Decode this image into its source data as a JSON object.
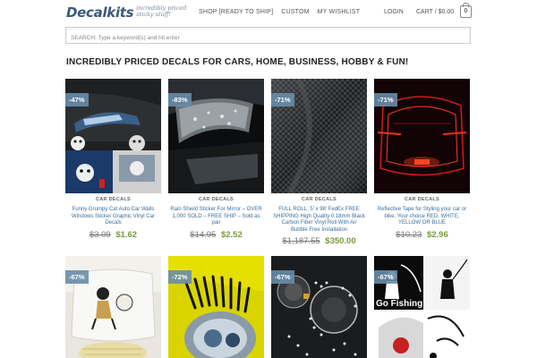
{
  "header": {
    "logo_text": "Decalkits",
    "logo_tagline_1": "incredibly priced",
    "logo_tagline_2": "sticky stuff!",
    "nav": [
      "SHOP [READY TO SHIP]",
      "CUSTOM",
      "MY WISHLIST"
    ],
    "login": "LOGIN",
    "cart_label": "CART / $0.00",
    "cart_count": "0"
  },
  "search": {
    "placeholder": "SEARCH: Type a keyword(s) and hit enter"
  },
  "page_heading": "INCREDIBLY PRICED DECALS FOR CARS, HOME, BUSINESS, HOBBY & FUN!",
  "products": [
    {
      "badge": "-47%",
      "category": "CAR DECALS",
      "name": "Funny Grumpy Cat Auto Car Walls Windows Sticker Graphic Vinyl Car Decals",
      "old_price": "$3.09",
      "new_price": "$1.62",
      "image_overlay": ""
    },
    {
      "badge": "-83%",
      "category": "CAR DECALS",
      "name": "Rain Shield Sticker For Mirror – OVER 1,000 SOLD – FREE SHIP – Sold as pair",
      "old_price": "$14.95",
      "new_price": "$2.52",
      "image_overlay": ""
    },
    {
      "badge": "-71%",
      "category": "CAR DECALS",
      "name": "FULL ROLL: 5' x 98' FedEx FREE SHIPPING High Quality 0.18mm Black Carbon Fiber Vinyl Roll With Air Bubble Free Installation",
      "old_price": "$1,187.55",
      "new_price": "$350.00",
      "image_overlay": ""
    },
    {
      "badge": "-71%",
      "category": "CAR DECALS",
      "name": "Reflective Tape for Styling your car or bike. Your choice RED, WHITE, YELLOW OR BLUE",
      "old_price": "$10.23",
      "new_price": "$2.96",
      "image_overlay": ""
    },
    {
      "badge": "-67%",
      "image_overlay": ""
    },
    {
      "badge": "-72%",
      "image_overlay": ""
    },
    {
      "badge": "-67%",
      "image_overlay": ""
    },
    {
      "badge": "-67%",
      "image_overlay": "Go Fishing"
    }
  ]
}
